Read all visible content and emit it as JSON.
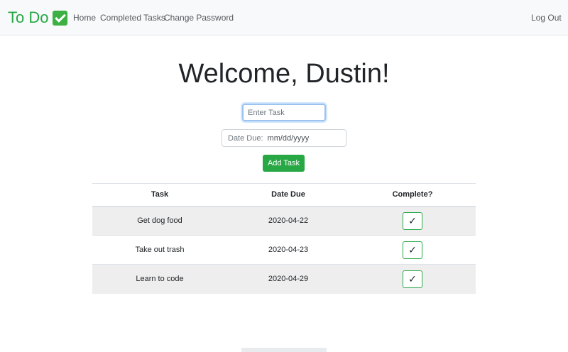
{
  "navbar": {
    "brand": "To Do",
    "brand_icon": "check-mark-button-icon",
    "links": [
      "Home",
      "Completed Tasks",
      "Change Password"
    ],
    "logout": "Log Out"
  },
  "main": {
    "welcome": "Welcome, Dustin!",
    "task_input": {
      "value": "",
      "placeholder": "Enter Task"
    },
    "date_due": {
      "label": "Date Due:",
      "value": "mm/dd/yyyy"
    },
    "add_button": "Add Task"
  },
  "table": {
    "headers": [
      "Task",
      "Date Due",
      "Complete?"
    ],
    "rows": [
      {
        "task": "Get dog food",
        "date": "2020-04-22",
        "complete_icon": "✓"
      },
      {
        "task": "Take out trash",
        "date": "2020-04-23",
        "complete_icon": "✓"
      },
      {
        "task": "Learn to code",
        "date": "2020-04-29",
        "complete_icon": "✓"
      }
    ]
  },
  "colors": {
    "brand": "#28a745",
    "navbar_bg": "#f8f9fa",
    "stripe": "#eeeeee",
    "focus_border": "#9cc3ee"
  }
}
